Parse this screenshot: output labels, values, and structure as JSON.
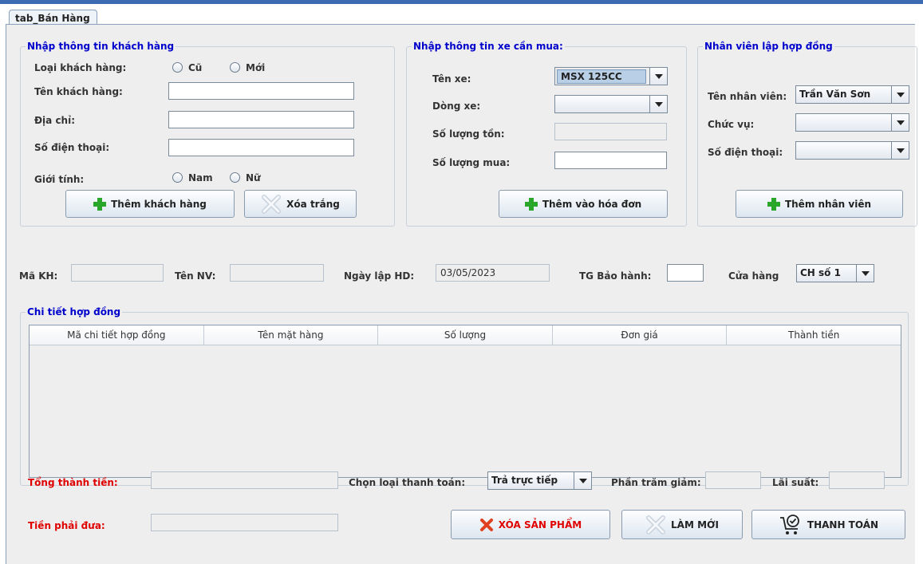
{
  "tab": {
    "label": "tab_Bán Hàng"
  },
  "customer": {
    "title": "Nhập thông tin khách hàng",
    "type_label": "Loại khách hàng:",
    "type_old": "Cũ",
    "type_new": "Mới",
    "name_label": "Tên khách hàng:",
    "address_label": "Địa chỉ:",
    "phone_label": "Số điện thoại:",
    "gender_label": "Giới tính:",
    "gender_male": "Nam",
    "gender_female": "Nữ",
    "add_button": "Thêm khách hàng",
    "clear_button": "Xóa trắng"
  },
  "vehicle": {
    "title": "Nhập thông tin xe cần mua:",
    "name_label": "Tên xe:",
    "name_value": "MSX 125CC",
    "line_label": "Dòng xe:",
    "line_value": "",
    "stock_label": "Số lượng tồn:",
    "qty_label": "Số lượng mua:",
    "add_button": "Thêm vào hóa đơn"
  },
  "staff": {
    "title": "Nhân viên lập hợp đồng",
    "name_label": "Tên nhân viên:",
    "name_value": "Trần Văn Sơn",
    "position_label": "Chức vụ:",
    "position_value": "",
    "phone_label": "Số điện thoại:",
    "phone_value": "",
    "add_button": "Thêm nhân viên"
  },
  "info": {
    "customer_id_label": "Mã KH:",
    "staff_name_label": "Tên NV:",
    "date_label": "Ngày lập HD:",
    "date_value": "03/05/2023",
    "warranty_label": "TG Bảo hành:",
    "store_label": "Cửa hàng",
    "store_value": "CH số 1"
  },
  "details": {
    "title": "Chi tiết hợp đồng",
    "columns": [
      "Mã chi tiết hợp đồng",
      "Tên mặt hàng",
      "Số lượng",
      "Đơn giá",
      "Thành tiền"
    ],
    "rows": []
  },
  "payment": {
    "total_label": "Tổng thành tiền:",
    "method_label": "Chọn loại thanh toán:",
    "method_value": "Trả trực tiếp",
    "discount_label": "Phần trăm giảm:",
    "interest_label": "Lãi suất:",
    "due_label": "Tiền phải đưa:",
    "delete_button": "XÓA SẢN PHẨM",
    "refresh_button": "LÀM MỚI",
    "pay_button": "THANH TOÁN"
  },
  "colors": {
    "group_title": "#0000cc",
    "required_label": "#e00000",
    "plus_icon": "#2aa62a",
    "delete_icon": "#e04020",
    "top_strip": "#3d6bb3"
  }
}
